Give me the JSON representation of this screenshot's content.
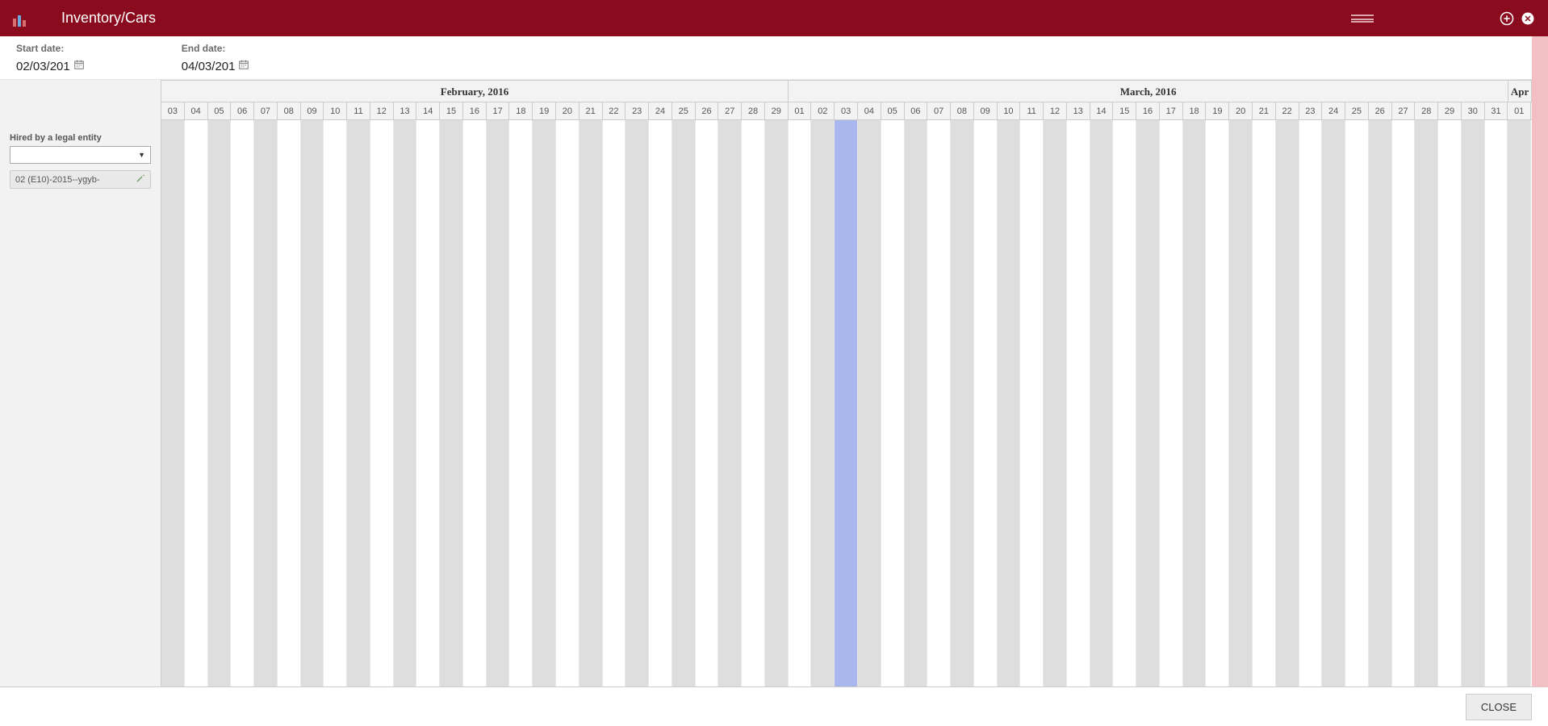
{
  "header": {
    "title": "Inventory/Cars"
  },
  "dates": {
    "start_label": "Start date:",
    "start_value": "02/03/201",
    "end_label": "End date:",
    "end_value": "04/03/201"
  },
  "sidebar": {
    "section_label": "Hired by a legal entity",
    "entity_item": "02 (E10)-2015--ygyb-"
  },
  "calendar": {
    "months": [
      {
        "label": "February, 2016",
        "days": 27
      },
      {
        "label": "March, 2016",
        "days": 31
      },
      {
        "label": "Apr",
        "days": 1
      }
    ],
    "days": [
      "03",
      "04",
      "05",
      "06",
      "07",
      "08",
      "09",
      "10",
      "11",
      "12",
      "13",
      "14",
      "15",
      "16",
      "17",
      "18",
      "19",
      "20",
      "21",
      "22",
      "23",
      "24",
      "25",
      "26",
      "27",
      "28",
      "29",
      "01",
      "02",
      "03",
      "04",
      "05",
      "06",
      "07",
      "08",
      "09",
      "10",
      "11",
      "12",
      "13",
      "14",
      "15",
      "16",
      "17",
      "18",
      "19",
      "20",
      "21",
      "22",
      "23",
      "24",
      "25",
      "26",
      "27",
      "28",
      "29",
      "30",
      "31",
      "01"
    ],
    "highlight_index": 29
  },
  "footer": {
    "close_label": "CLOSE"
  }
}
